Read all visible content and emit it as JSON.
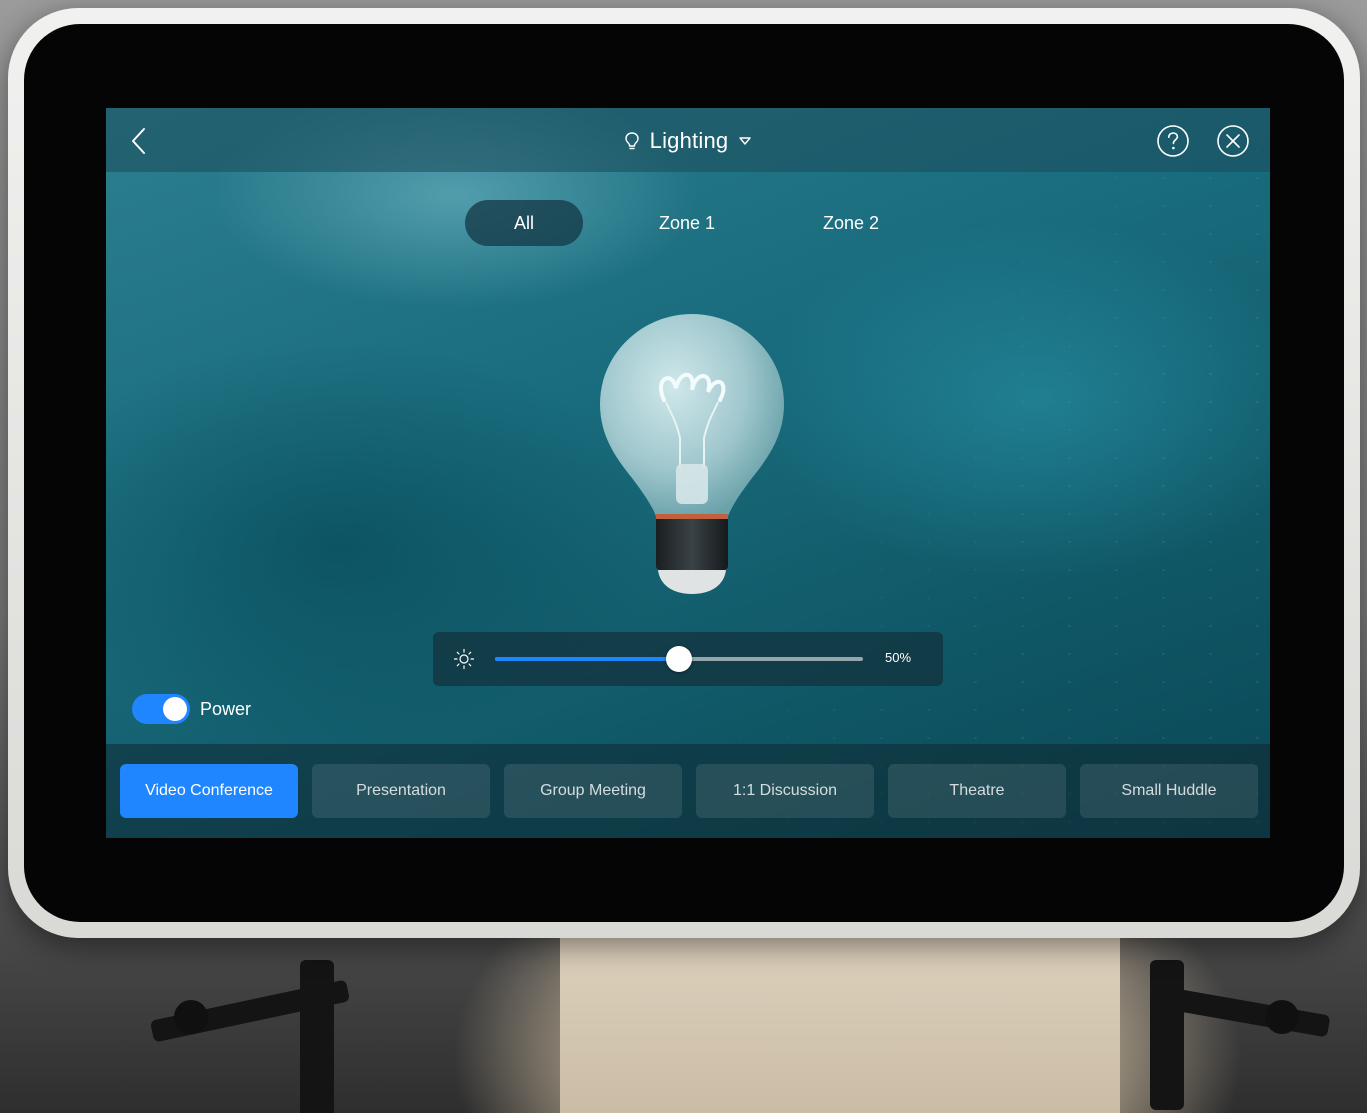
{
  "header": {
    "title": "Lighting",
    "back_icon": "chevron-left-icon",
    "help_icon": "help-circle-icon",
    "close_icon": "close-circle-icon",
    "title_icon": "lightbulb-icon",
    "dropdown_icon": "triangle-down-icon"
  },
  "zones": {
    "tabs": [
      {
        "label": "All",
        "active": true
      },
      {
        "label": "Zone 1",
        "active": false
      },
      {
        "label": "Zone 2",
        "active": false
      }
    ]
  },
  "brightness": {
    "icon": "sun-icon",
    "value_percent": 50,
    "value_label": "50%"
  },
  "power": {
    "label": "Power",
    "on": true
  },
  "scenes": [
    {
      "label": "Video Conference",
      "active": true
    },
    {
      "label": "Presentation",
      "active": false
    },
    {
      "label": "Group Meeting",
      "active": false
    },
    {
      "label": "1:1 Discussion",
      "active": false
    },
    {
      "label": "Theatre",
      "active": false
    },
    {
      "label": "Small Huddle",
      "active": false
    }
  ],
  "colors": {
    "accent": "#1f86ff",
    "screen_bg": "#196c7d"
  }
}
